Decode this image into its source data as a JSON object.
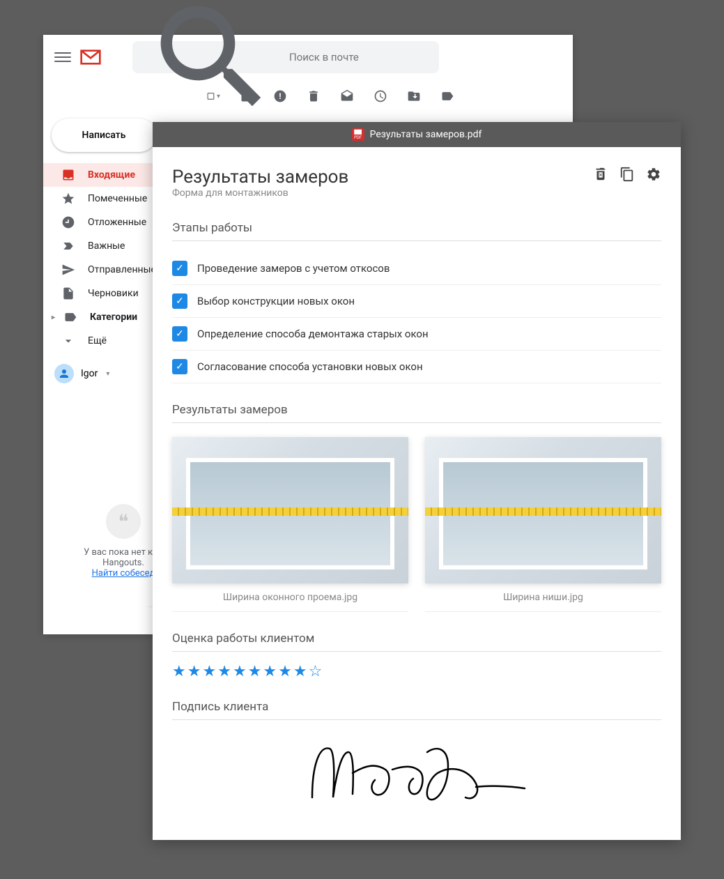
{
  "gmail": {
    "search_placeholder": "Поиск в почте",
    "compose": "Написать",
    "nav": [
      {
        "label": "Входящие"
      },
      {
        "label": "Помеченные"
      },
      {
        "label": "Отложенные"
      },
      {
        "label": "Важные"
      },
      {
        "label": "Отправленные"
      },
      {
        "label": "Черновики"
      },
      {
        "label": "Категории"
      },
      {
        "label": "Ещё"
      }
    ],
    "user": "Igor",
    "hangouts_line1": "У вас пока нет кон",
    "hangouts_line2": "Hangouts.",
    "hangouts_link": "Найти собесед"
  },
  "pdf": {
    "filename": "Результаты замеров.pdf",
    "title": "Результаты замеров",
    "subtitle": "Форма для монтажников",
    "section_stages": "Этапы работы",
    "stages": [
      "Проведение замеров с учетом откосов",
      "Выбор конструкции новых окон",
      "Определение способа демонтажа старых окон",
      "Согласование способа установки новых окон"
    ],
    "section_results": "Результаты замеров",
    "images": [
      {
        "caption": "Ширина оконного проема.jpg"
      },
      {
        "caption": "Ширина ниши.jpg"
      }
    ],
    "section_rating": "Оценка работы клиентом",
    "rating": {
      "value": 9,
      "max": 10
    },
    "section_signature": "Подпись клиента"
  }
}
